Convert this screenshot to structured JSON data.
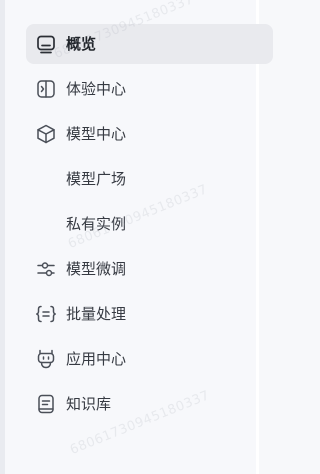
{
  "nav": {
    "items": [
      {
        "label": "概览",
        "icon": "monitor-icon",
        "active": true
      },
      {
        "label": "体验中心",
        "icon": "experience-icon"
      },
      {
        "label": "模型中心",
        "icon": "cube-icon"
      },
      {
        "label": "模型广场"
      },
      {
        "label": "私有实例"
      },
      {
        "label": "模型微调",
        "icon": "sliders-icon"
      },
      {
        "label": "批量处理",
        "icon": "braces-list-icon"
      },
      {
        "label": "应用中心",
        "icon": "robot-icon"
      },
      {
        "label": "知识库",
        "icon": "book-icon"
      }
    ]
  },
  "watermark": {
    "text": "68061730945180337"
  },
  "colors": {
    "background": "#f7f8fb",
    "active_bg": "#e9eaee",
    "text": "#363a42",
    "icon": "#4a4f58"
  }
}
